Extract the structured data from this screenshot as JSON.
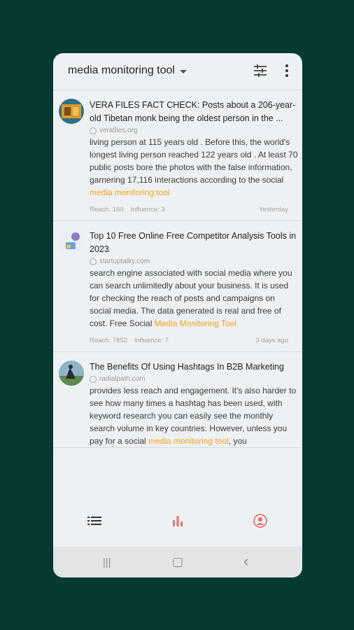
{
  "app": {
    "title": "media monitoring tool"
  },
  "icons": {
    "filter": "sliders-icon",
    "more": "more-vertical-icon"
  },
  "colors": {
    "highlight": "#f4a31a",
    "background": "#053a33",
    "active_nav": "#333333",
    "inactive_nav": "#e57373"
  },
  "feed": [
    {
      "title": "VERA FILES FACT CHECK: Posts about a 206-year-old Tibetan monk being the oldest person in the ...",
      "domain": "verafiles.org",
      "snippet_pre": "living person at 115 years old . Before this, the world's longest living person reached 122 years old . At least 70 public posts bore the photos with the false information, garnering 17,116 interactions according to the social ",
      "snippet_hl": "media monitoring tool",
      "snippet_post": "",
      "reach": "Reach: 160",
      "influence": "Influence: 3",
      "time": "Yesterday"
    },
    {
      "title": "Top 10 Free Online Free Competitor Analysis Tools in 2023",
      "domain": "startuptalky.com",
      "snippet_pre": "search engine associated with social media where you can search unlimitedly about your business. It is used for checking the reach of posts and campaigns on social media. The data generated is real and free of cost. Free Social ",
      "snippet_hl": "Media Monitoring Tool",
      "snippet_post": "",
      "reach": "Reach: 7852",
      "influence": "Influence: 7",
      "time": "3 days ago"
    },
    {
      "title": "The Benefits Of Using Hashtags In B2B Marketing",
      "domain": "radialpath.com",
      "snippet_pre": "provides less reach and engagement. It's also harder to see how many times a hashtag has been used, with keyword research you can easily see the monthly search volume in key countries. However, unless you pay for a social ",
      "snippet_hl": "media monitoring tool",
      "snippet_post": ", you",
      "reach": "",
      "influence": "",
      "time": ""
    }
  ],
  "nav": [
    "list-icon",
    "bar-chart-icon",
    "account-icon"
  ],
  "system_nav": {
    "recents": "|||",
    "home": "▢",
    "back": "‹"
  }
}
